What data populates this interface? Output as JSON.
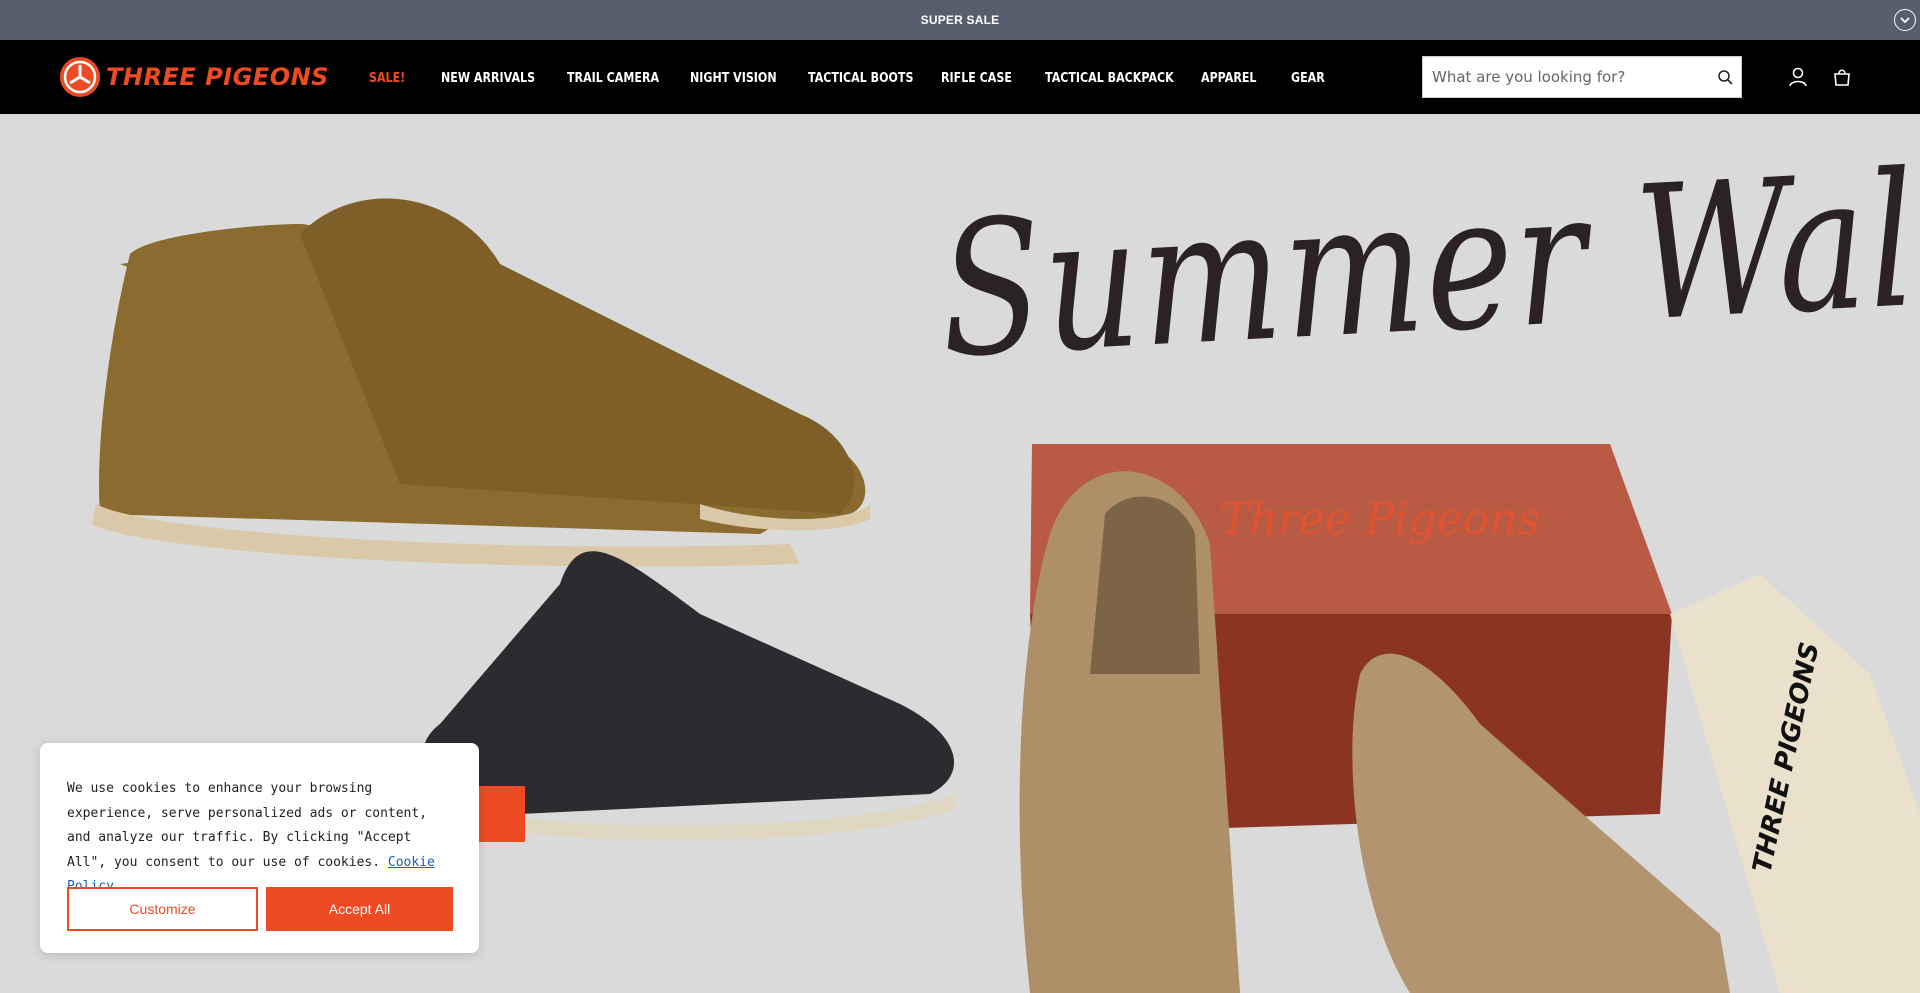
{
  "announcement": {
    "text": "SUPER SALE",
    "toggle_icon": "chevron-down-icon"
  },
  "header": {
    "logo_text": "THREE PIGEONS",
    "nav": [
      {
        "label": "SALE!"
      },
      {
        "label": "NEW ARRIVALS"
      },
      {
        "label": "TRAIL CAMERA"
      },
      {
        "label": "NIGHT VISION"
      },
      {
        "label": "TACTICAL BOOTS"
      },
      {
        "label": "RIFLE CASE"
      },
      {
        "label": "TACTICAL BACKPACK"
      },
      {
        "label": "APPAREL"
      },
      {
        "label": "GEAR"
      }
    ],
    "search": {
      "placeholder": "What are you looking for?",
      "value": ""
    },
    "icons": [
      "search-icon",
      "account-icon",
      "cart-icon"
    ]
  },
  "hero": {
    "title": "Summer Walk",
    "box_brand": "Three Pigeons",
    "bag_brand": "THREE PIGEONS"
  },
  "cookie": {
    "text": "We use cookies to enhance your browsing experience, serve personalized ads or content, and analyze our traffic. By clicking \"Accept All\", you consent to our use of cookies.",
    "link_label": "Cookie Policy",
    "customize_label": "Customize",
    "accept_label": "Accept All"
  },
  "colors": {
    "accent": "#ee4b24",
    "announcement_bg": "#575e6e",
    "header_bg": "#000000",
    "hero_bg": "#dadada"
  }
}
